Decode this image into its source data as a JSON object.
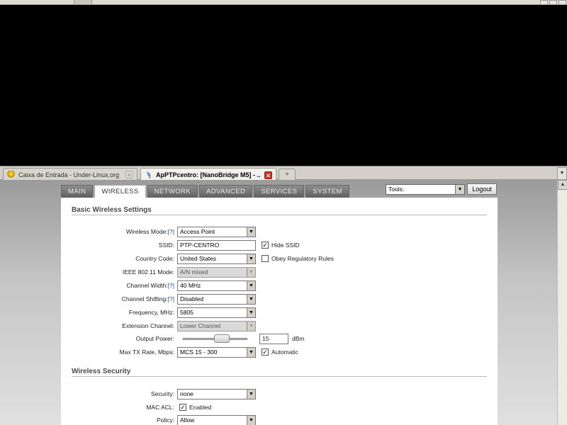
{
  "browser": {
    "tabs": [
      {
        "title": "Caixa de Entrada - Under-Linux.org",
        "active": false,
        "icon": "mail-icon"
      },
      {
        "title": "ApPTPcentro: [NanoBridge M5] - ...",
        "active": true,
        "icon": "wifi-icon"
      }
    ],
    "new_tab_symbol": "+",
    "close_symbol": "×"
  },
  "nav": {
    "tabs": [
      "MAIN",
      "WIRELESS",
      "NETWORK",
      "ADVANCED",
      "SERVICES",
      "SYSTEM"
    ],
    "active_tab": "WIRELESS"
  },
  "tools": {
    "selected": "Tools:"
  },
  "logout_label": "Logout",
  "basic": {
    "title": "Basic Wireless Settings",
    "help": "[?]",
    "wireless_mode": {
      "label": "Wireless Mode:",
      "value": "Access Point"
    },
    "ssid": {
      "label": "SSID:",
      "value": "PTP-CENTRO",
      "hide_label": "Hide SSID",
      "hide_checked": true
    },
    "country": {
      "label": "Country Code:",
      "value": "United States",
      "obey_label": "Obey Regulatory Rules",
      "obey_checked": false
    },
    "ieee_mode": {
      "label": "IEEE 802.11 Mode:",
      "value": "A/N mixed"
    },
    "channel_width": {
      "label": "Channel Width:",
      "value": "40 MHz"
    },
    "channel_shifting": {
      "label": "Channel Shifting:",
      "value": "Disabled"
    },
    "frequency": {
      "label": "Frequency, MHz:",
      "value": "5805"
    },
    "extension_channel": {
      "label": "Extension Channel:",
      "value": "Lower Channel"
    },
    "output_power": {
      "label": "Output Power:",
      "value": "15",
      "unit": "dBm"
    },
    "max_tx": {
      "label": "Max TX Rate, Mbps:",
      "value": "MCS 15 - 300",
      "auto_label": "Automatic",
      "auto_checked": true
    }
  },
  "security": {
    "title": "Wireless Security",
    "security": {
      "label": "Security:",
      "value": "none"
    },
    "mac_acl": {
      "label": "MAC ACL:",
      "enabled_label": "Enabled",
      "checked": true
    },
    "policy": {
      "label": "Policy:",
      "value": "Allow"
    }
  },
  "colors": {
    "accent_help": "#2a55a0",
    "nav_tab_bg": "#6f6f6f",
    "close_active": "#c9372c"
  }
}
